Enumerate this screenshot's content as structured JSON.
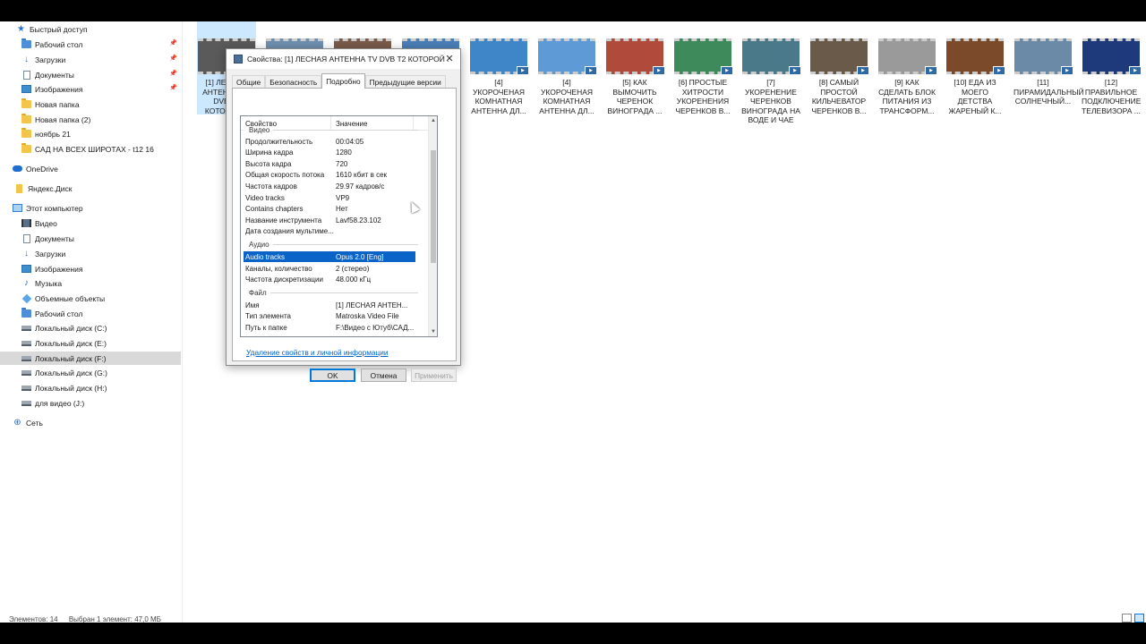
{
  "sidebar": {
    "items": [
      {
        "label": "Быстрый доступ",
        "icon": "star-icon",
        "pinned": false
      },
      {
        "label": "Рабочий стол",
        "icon": "folder-blue-icon",
        "pinned": true
      },
      {
        "label": "Загрузки",
        "icon": "download-icon",
        "pinned": true
      },
      {
        "label": "Документы",
        "icon": "document-icon",
        "pinned": true
      },
      {
        "label": "Изображения",
        "icon": "image-icon",
        "pinned": true
      },
      {
        "label": "Новая папка",
        "icon": "folder-icon",
        "pinned": false
      },
      {
        "label": "Новая папка (2)",
        "icon": "folder-icon",
        "pinned": false
      },
      {
        "label": "ноябрь 21",
        "icon": "folder-icon",
        "pinned": false
      },
      {
        "label": "САД НА ВСЕХ ШИРОТАХ - t12 16",
        "icon": "folder-icon",
        "pinned": false
      },
      {
        "label": "OneDrive",
        "icon": "cloud-icon",
        "pinned": false
      },
      {
        "label": "Яндекс.Диск",
        "icon": "yandex-disk-icon",
        "pinned": false
      },
      {
        "label": "Этот компьютер",
        "icon": "computer-icon",
        "pinned": false
      },
      {
        "label": "Видео",
        "icon": "video-icon",
        "pinned": false
      },
      {
        "label": "Документы",
        "icon": "document-icon",
        "pinned": false
      },
      {
        "label": "Загрузки",
        "icon": "download-icon",
        "pinned": false
      },
      {
        "label": "Изображения",
        "icon": "image-icon",
        "pinned": false
      },
      {
        "label": "Музыка",
        "icon": "music-icon",
        "pinned": false
      },
      {
        "label": "Объемные объекты",
        "icon": "3d-objects-icon",
        "pinned": false
      },
      {
        "label": "Рабочий стол",
        "icon": "folder-blue-icon",
        "pinned": false
      },
      {
        "label": "Локальный диск (C:)",
        "icon": "drive-icon",
        "pinned": false
      },
      {
        "label": "Локальный диск (E:)",
        "icon": "drive-icon",
        "pinned": false
      },
      {
        "label": "Локальный диск (F:)",
        "icon": "drive-icon",
        "pinned": false,
        "selected": true
      },
      {
        "label": "Локальный диск (G:)",
        "icon": "drive-icon",
        "pinned": false
      },
      {
        "label": "Локальный диск (H:)",
        "icon": "drive-icon",
        "pinned": false
      },
      {
        "label": "для видео  (J:)",
        "icon": "drive-icon",
        "pinned": false
      },
      {
        "label": "Сеть",
        "icon": "network-icon",
        "pinned": false
      }
    ]
  },
  "files": [
    {
      "label": "[1] ЛЕСНАЯ АНТЕННА TV DVB T2 КОТОРОЙ...",
      "selected": true,
      "thumb_color": "#5a5a5a"
    },
    {
      "label": "",
      "selected": false,
      "thumb_color": "#6f8fb0"
    },
    {
      "label": "",
      "selected": false,
      "thumb_color": "#7a5a4a"
    },
    {
      "label": "",
      "selected": false,
      "thumb_color": "#4a7fb8"
    },
    {
      "label": "[4] УКОРОЧЕНАЯ КОМНАТНАЯ АНТЕННА ДЛ...",
      "selected": false,
      "thumb_color": "#3f86c9"
    },
    {
      "label": "[4] УКОРОЧЕНАЯ КОМНАТНАЯ АНТЕННА ДЛ...",
      "selected": false,
      "thumb_color": "#5d9ad6"
    },
    {
      "label": "[5] КАК ВЫМОЧИТЬ ЧЕРЕНОК ВИНОГРАДА ...",
      "selected": false,
      "thumb_color": "#b04a3a"
    },
    {
      "label": "[6] ПРОСТЫЕ ХИТРОСТИ УКОРЕНЕНИЯ ЧЕРЕНКОВ В...",
      "selected": false,
      "thumb_color": "#3f8a5a"
    },
    {
      "label": "[7] УКОРЕНЕНИЕ ЧЕРЕНКОВ ВИНОГРАДА НА ВОДЕ И ЧАЕ",
      "selected": false,
      "thumb_color": "#4a7a8a"
    },
    {
      "label": "[8] САМЫЙ ПРОСТОЙ КИЛЬЧЕВАТОР ЧЕРЕНКОВ В...",
      "selected": false,
      "thumb_color": "#6a5a4a"
    },
    {
      "label": "[9] КАК СДЕЛАТЬ БЛОК ПИТАНИЯ ИЗ ТРАНСФОРМ...",
      "selected": false,
      "thumb_color": "#9a9a9a"
    },
    {
      "label": "[10] ЕДА ИЗ МОЕГО ДЕТСТВА ЖАРЕНЫЙ К...",
      "selected": false,
      "thumb_color": "#7a4a2a"
    },
    {
      "label": "[11] ПИРАМИДАЛЬНЫЙ СОЛНЕЧНЫЙ...",
      "selected": false,
      "thumb_color": "#6a8aa8"
    },
    {
      "label": "[12] ПРАВИЛЬНОЕ ПОДКЛЮЧЕНИЕ ТЕЛЕВИЗОРА ...",
      "selected": false,
      "thumb_color": "#1e3a7a"
    }
  ],
  "dialog": {
    "title": "Свойства: [1] ЛЕСНАЯ  АНТЕННА TV DVB T2 КОТОРОЙ ...",
    "tabs": [
      {
        "label": "Общие",
        "active": false
      },
      {
        "label": "Безопасность",
        "active": false
      },
      {
        "label": "Подробно",
        "active": true
      },
      {
        "label": "Предыдущие версии",
        "active": false
      }
    ],
    "columns": {
      "property": "Свойство",
      "value": "Значение"
    },
    "partial_group": "Видео",
    "rows_video": [
      {
        "k": "Продолжительность",
        "v": "00:04:05"
      },
      {
        "k": "Ширина кадра",
        "v": "1280"
      },
      {
        "k": "Высота кадра",
        "v": "720"
      },
      {
        "k": "Общая скорость потока",
        "v": "1610 кбит в сек"
      },
      {
        "k": "Частота кадров",
        "v": "29.97 кадров/с"
      },
      {
        "k": "Video tracks",
        "v": "VP9"
      },
      {
        "k": "Contains chapters",
        "v": "Нет"
      },
      {
        "k": "Название инструмента",
        "v": "Lavf58.23.102"
      },
      {
        "k": "Дата создания мультиме...",
        "v": ""
      }
    ],
    "group_audio": "Аудио",
    "rows_audio": [
      {
        "k": "Audio tracks",
        "v": "Opus 2.0 [Eng]",
        "highlight": true
      },
      {
        "k": "Каналы, количество",
        "v": "2 (стерео)"
      },
      {
        "k": "Частота дискретизации",
        "v": "48.000 кГц"
      }
    ],
    "group_file": "Файл",
    "rows_file": [
      {
        "k": "Имя",
        "v": "[1] ЛЕСНАЯ  АНТЕН..."
      },
      {
        "k": "Тип элемента",
        "v": "Matroska Video File"
      },
      {
        "k": "Путь к папке",
        "v": "F:\\Видео с Ютуб\\САД..."
      }
    ],
    "remove_link": "Удаление свойств и личной информации",
    "buttons": {
      "ok": "OK",
      "cancel": "Отмена",
      "apply": "Применить"
    }
  },
  "status": {
    "items_count": "Элементов: 14",
    "selected": "Выбран 1 элемент: 47,0 МБ"
  },
  "colors": {
    "selection": "#0a64c8",
    "link": "#0066cc",
    "thumb_selected": "#cce8ff"
  }
}
